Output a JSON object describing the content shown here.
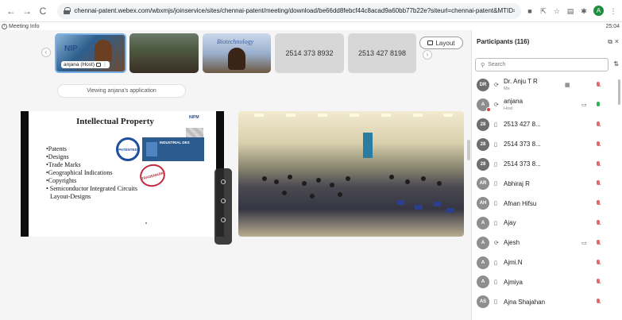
{
  "browser": {
    "url": "chennai-patent.webex.com/wbxmjs/joinservice/sites/chennai-patent/meeting/download/be66dd8febcf44c8acad9a60bb77b22e?siteurl=chennai-patent&MTID=m49d5d0...",
    "back_icon": "←",
    "forward_icon": "→",
    "reload_icon": "C",
    "profile_letter": "A"
  },
  "meeting": {
    "info_label": "Meeting Info",
    "time": "25:04"
  },
  "thumbnails": {
    "host_label": "anjana (Host)",
    "slide_brand": "NIP",
    "biotech_sign": "Biotechnology",
    "number1": "2514 373 8932",
    "number2": "2513 427 8198"
  },
  "layout_button": "Layout",
  "viewing_text": "Viewing anjana's application",
  "slide": {
    "title": "Intellectual Property",
    "bullets": [
      "•Patents",
      "•Designs",
      "•Trade Marks",
      "•Geographical Indications",
      "•Copyrights",
      "• Semiconductor Integrated Circuits",
      "  Layout-Designs"
    ],
    "stamp_patented": "PATENTED",
    "stamp_trademark": "TRADEMARK",
    "industrial_label": "INDUSTRIAL DES",
    "logo_text": "NIPM"
  },
  "panel": {
    "title": "Participants (116)",
    "search_placeholder": "Search",
    "participants": [
      {
        "initials": "DR",
        "name": "Dr. Anju T R",
        "sub": "Me"
      },
      {
        "initials": "A",
        "name": "anjana",
        "sub": "Host"
      },
      {
        "initials": "28",
        "name": "2513 427 8..."
      },
      {
        "initials": "28",
        "name": "2514 373 8..."
      },
      {
        "initials": "28",
        "name": "2514 373 8..."
      },
      {
        "initials": "AR",
        "name": "Abhiraj R"
      },
      {
        "initials": "AH",
        "name": "Afnan Hifsu"
      },
      {
        "initials": "A",
        "name": "Ajay"
      },
      {
        "initials": "A",
        "name": "Ajesh"
      },
      {
        "initials": "A",
        "name": "Ajmi.N"
      },
      {
        "initials": "A",
        "name": "Ajmiya"
      },
      {
        "initials": "AS",
        "name": "Ajna Shajahan"
      }
    ]
  }
}
